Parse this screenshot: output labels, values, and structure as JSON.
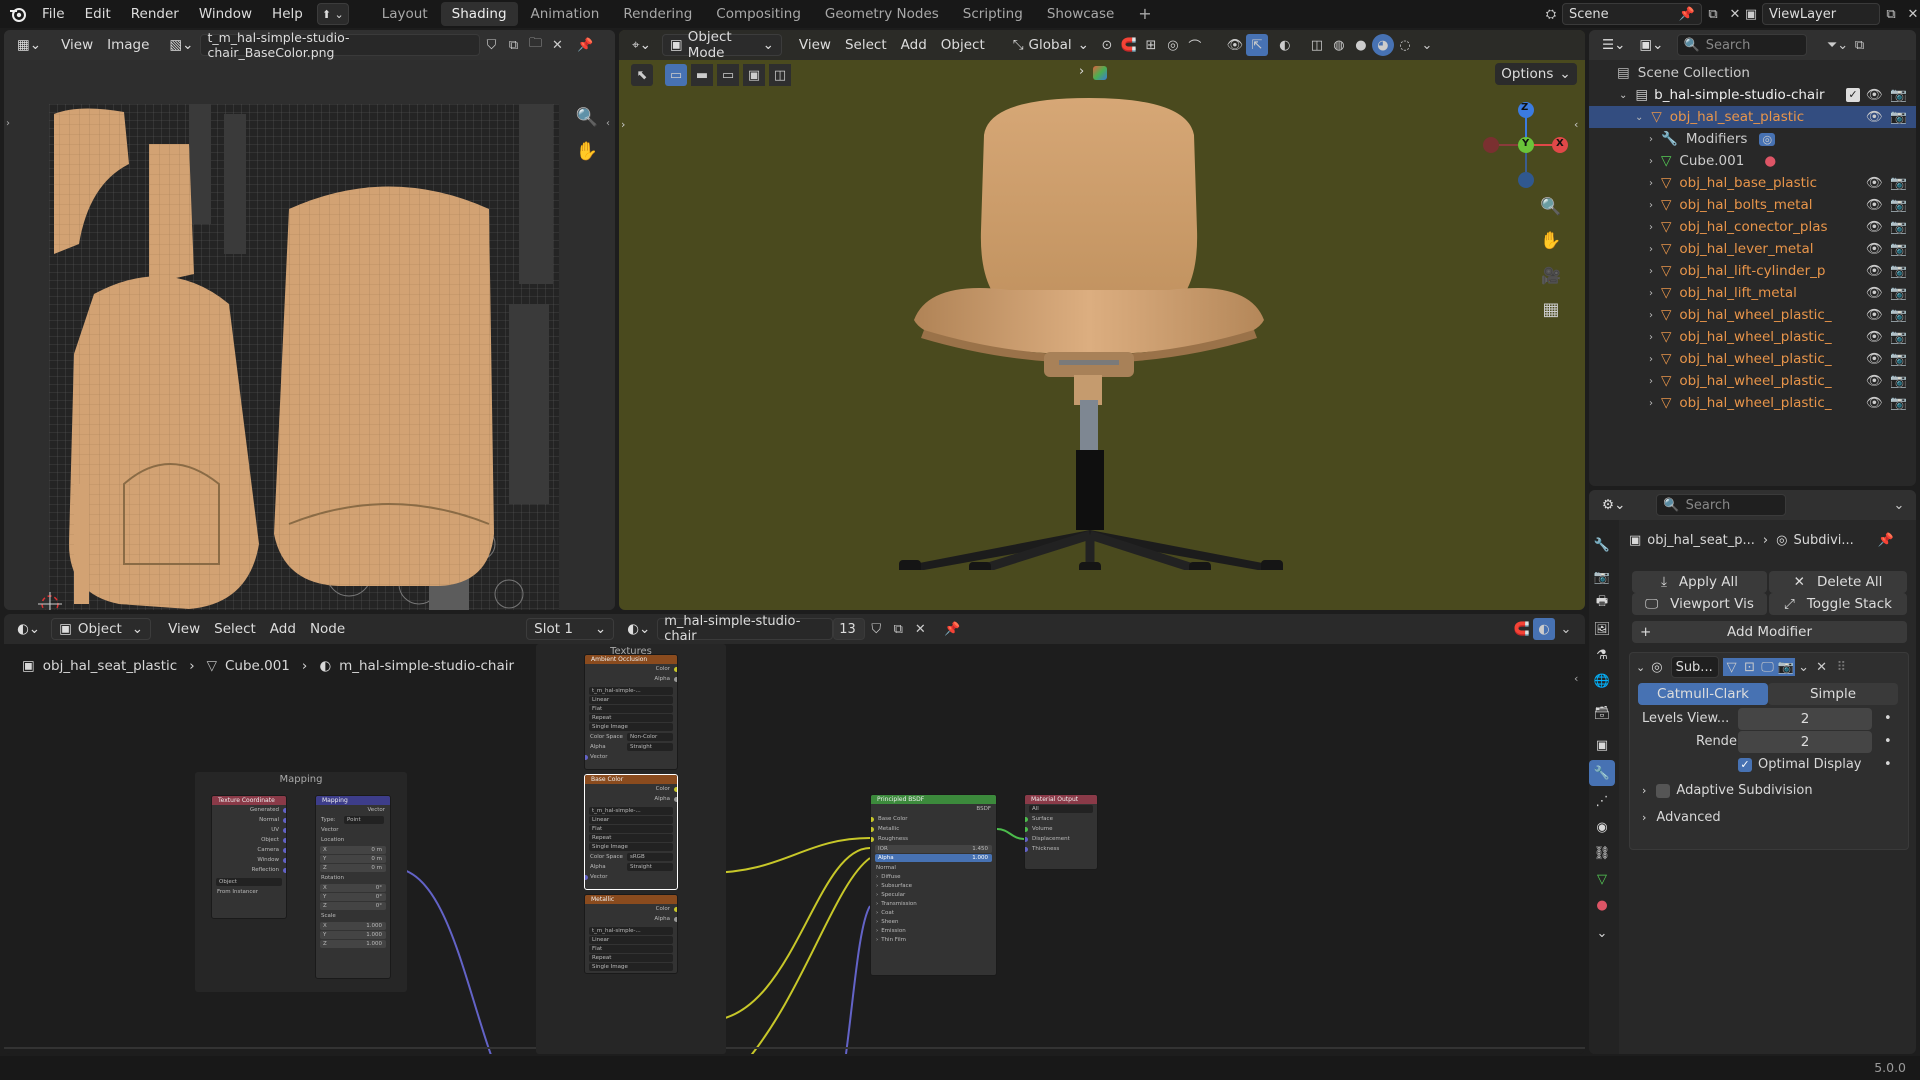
{
  "topbar": {
    "menus": [
      "File",
      "Edit",
      "Render",
      "Window",
      "Help"
    ],
    "workspaces": [
      "Layout",
      "Shading",
      "Animation",
      "Rendering",
      "Compositing",
      "Geometry Nodes",
      "Scripting",
      "Showcase"
    ],
    "active_workspace": "Shading",
    "scene": "Scene",
    "view_layer": "ViewLayer"
  },
  "image_editor": {
    "menus": [
      "View",
      "Image"
    ],
    "image_name": "t_m_hal-simple-studio-chair_BaseColor.png"
  },
  "viewport": {
    "mode": "Object Mode",
    "menus": [
      "View",
      "Select",
      "Add",
      "Object"
    ],
    "orientation": "Global",
    "options": "Options",
    "gizmo": {
      "z": "Z",
      "y": "Y",
      "x": "X"
    }
  },
  "outliner": {
    "search_placeholder": "Search",
    "scene_collection": "Scene Collection",
    "collection": "b_hal-simple-studio-chair",
    "items": [
      {
        "name": "obj_hal_seat_plastic",
        "level": 2,
        "type": "object",
        "selected": true
      },
      {
        "name": "Modifiers",
        "level": 3,
        "type": "modifiers"
      },
      {
        "name": "Cube.001",
        "level": 3,
        "type": "mesh"
      },
      {
        "name": "obj_hal_base_plastic",
        "level": 3,
        "type": "object"
      },
      {
        "name": "obj_hal_bolts_metal",
        "level": 3,
        "type": "object"
      },
      {
        "name": "obj_hal_conector_plas",
        "level": 3,
        "type": "object"
      },
      {
        "name": "obj_hal_lever_metal",
        "level": 3,
        "type": "object"
      },
      {
        "name": "obj_hal_lift-cylinder_p",
        "level": 3,
        "type": "object"
      },
      {
        "name": "obj_hal_lift_metal",
        "level": 3,
        "type": "object"
      },
      {
        "name": "obj_hal_wheel_plastic_",
        "level": 3,
        "type": "object"
      },
      {
        "name": "obj_hal_wheel_plastic_",
        "level": 3,
        "type": "object"
      },
      {
        "name": "obj_hal_wheel_plastic_",
        "level": 3,
        "type": "object"
      },
      {
        "name": "obj_hal_wheel_plastic_",
        "level": 3,
        "type": "object"
      },
      {
        "name": "obj_hal_wheel_plastic_",
        "level": 3,
        "type": "object"
      }
    ]
  },
  "properties": {
    "search_placeholder": "Search",
    "breadcrumb_object": "obj_hal_seat_p...",
    "breadcrumb_modifier": "Subdivi...",
    "apply_all": "Apply All",
    "delete_all": "Delete All",
    "viewport_vis": "Viewport Vis",
    "toggle_stack": "Toggle Stack",
    "add_modifier": "Add Modifier",
    "modifier_name": "Sub...",
    "catmull": "Catmull-Clark",
    "simple": "Simple",
    "levels_label": "Levels View...",
    "levels_value": "2",
    "render_label": "Render",
    "render_value": "2",
    "optimal_display": "Optimal Display",
    "adaptive": "Adaptive Subdivision",
    "advanced": "Advanced"
  },
  "node_editor": {
    "type": "Object",
    "menus": [
      "View",
      "Select",
      "Add",
      "Node"
    ],
    "slot": "Slot 1",
    "material": "m_hal-simple-studio-chair",
    "users": "13",
    "breadcrumb": [
      "obj_hal_seat_plastic",
      "Cube.001",
      "m_hal-simple-studio-chair"
    ],
    "frame_mapping": "Mapping",
    "frame_textures": "Textures",
    "tex_coord": {
      "title": "Texture Coordinate",
      "outputs": [
        "Generated",
        "Normal",
        "UV",
        "Object",
        "Camera",
        "Window",
        "Reflection"
      ],
      "object": "Object",
      "from_instancer": "From Instancer"
    },
    "mapping": {
      "title": "Mapping",
      "out": "Vector",
      "type_label": "Type:",
      "type": "Point",
      "vector": "Vector",
      "location": "Location",
      "rotation": "Rotation",
      "scale": "Scale",
      "loc": [
        "0 m",
        "0 m",
        "0 m"
      ],
      "rot": [
        "0°",
        "0°",
        "0°"
      ],
      "scl": [
        "1.000",
        "1.000",
        "1.000"
      ],
      "axes": [
        "X",
        "Y",
        "Z"
      ]
    },
    "tex_nodes": [
      {
        "title": "Ambient Occlusion",
        "img": "t_m_hal-simple-...",
        "interp": "Linear",
        "proj": "Flat",
        "ext": "Repeat",
        "src": "Single Image",
        "cs_label": "Color Space",
        "cs": "Non-Color",
        "alpha_label": "Alpha",
        "alpha": "Straight",
        "vector": "Vector"
      },
      {
        "title": "Base Color",
        "img": "t_m_hal-simple-...",
        "interp": "Linear",
        "proj": "Flat",
        "ext": "Repeat",
        "src": "Single Image",
        "cs_label": "Color Space",
        "cs": "sRGB",
        "alpha_label": "Alpha",
        "alpha": "Straight",
        "vector": "Vector"
      },
      {
        "title": "Metallic",
        "img": "t_m_hal-simple-...",
        "interp": "Linear",
        "proj": "Flat",
        "ext": "Repeat",
        "src": "Single Image"
      }
    ],
    "tex_out": [
      "Color",
      "Alpha"
    ],
    "bsdf": {
      "title": "Principled BSDF",
      "out": "BSDF",
      "inputs": [
        "Base Color",
        "Metallic",
        "Roughness"
      ],
      "ior_label": "IOR",
      "ior": "1.450",
      "alpha_label": "Alpha",
      "alpha": "1.000",
      "normal": "Normal",
      "panels": [
        "Diffuse",
        "Subsurface",
        "Specular",
        "Transmission",
        "Coat",
        "Sheen",
        "Emission",
        "Thin Film"
      ]
    },
    "output": {
      "title": "Material Output",
      "target": "All",
      "inputs": [
        "Surface",
        "Volume",
        "Displacement",
        "Thickness"
      ]
    }
  },
  "status": {
    "version": "5.0.0"
  },
  "colors": {
    "accent": "#4772b3",
    "selection": "#334d80",
    "orange_obj": "#e8954a",
    "chair": "#d2a273",
    "viewport_bg": "#4a4a1e"
  }
}
